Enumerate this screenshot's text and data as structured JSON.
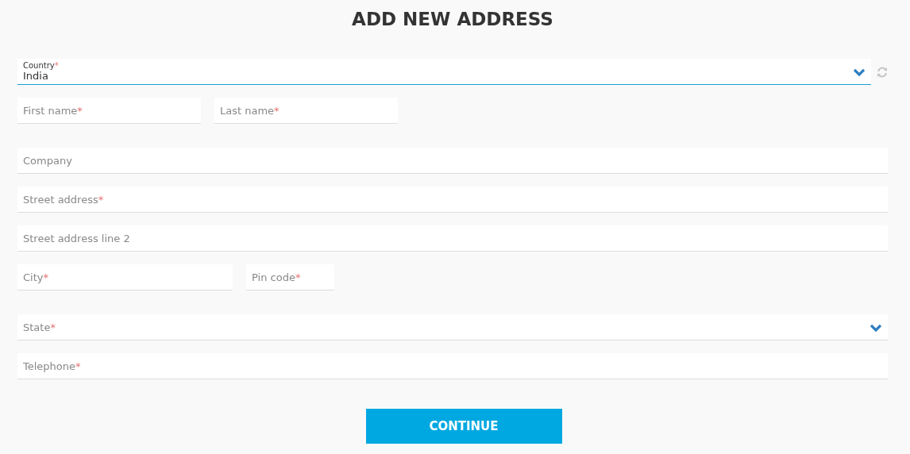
{
  "title": "ADD NEW ADDRESS",
  "country": {
    "label": "Country",
    "required_mark": "*",
    "value": "India",
    "focused": true
  },
  "rows": [
    [
      {
        "kind": "text",
        "placeholder": "First name",
        "required_mark": "*"
      },
      {
        "kind": "text",
        "placeholder": "Last name",
        "required_mark": "*"
      }
    ],
    [
      {
        "kind": "text",
        "placeholder": "Company"
      }
    ],
    [
      {
        "kind": "text",
        "placeholder": "Street address",
        "required_mark": "*"
      }
    ],
    [
      {
        "kind": "text",
        "placeholder": "Street address line 2"
      }
    ],
    [
      {
        "kind": "text",
        "placeholder": "City",
        "required_mark": "*"
      },
      {
        "kind": "text",
        "placeholder": "Pin code",
        "required_mark": "*"
      }
    ],
    [
      {
        "kind": "select",
        "placeholder": "State",
        "required_mark": "*"
      }
    ],
    [
      {
        "kind": "text",
        "placeholder": "Telephone",
        "required_mark": "*"
      }
    ]
  ],
  "continue_button": "CONTINUE"
}
